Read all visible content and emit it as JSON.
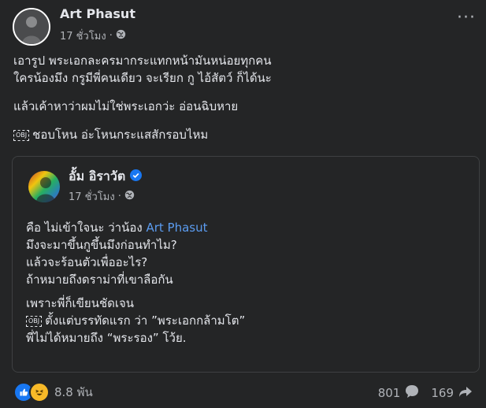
{
  "post": {
    "author": "Art Phasut",
    "time": "17 ชั่วโมง",
    "separator": "·",
    "audience_icon": "globe-icon",
    "body_lines": [
      "เอารูป พระเอกละครมากระแทกหน้ามันหน่อยทุกคน",
      "ใครน้องมึง กรูมีพี่คนเดียว จะเรียก กู ไอ้สัตว์ ก็ได้นะ",
      "แล้วเค้าหาว่าผมไม่ใช่พระเอกว่ะ  อ่อนฉิบหาย",
      "ชอบโหน อ่ะโหนกระแสสักรอบไหม"
    ],
    "obj_label": "OBJ"
  },
  "shared_post": {
    "author": "อั้ม อิราวัต",
    "verified_icon": "verified-badge-icon",
    "time": "17 ชั่วโมง",
    "separator": "·",
    "audience_icon": "globe-icon",
    "line1_prefix": "คือ ไม่เข้าใจนะ ว่าน้อง ",
    "line1_mention": "Art Phasut",
    "lines_a": [
      "มึงจะมาขึ้นกูขึ้นมึงก่อนทำไม?",
      "แล้วจะร้อนตัวเพื่ออะไร?",
      "ถ้าหมายถึงดราม่าที่เขาลือกัน"
    ],
    "lines_b": [
      "เพราะพี่ก็เขียนชัดเจน",
      "ตั้งแต่บรรทัดแรก ว่า ”พระเอกกล้ามโต”",
      "พี่ไม่ได้หมายถึง “พระรอง” โว้ย."
    ]
  },
  "footer": {
    "reaction_icons": [
      "like-icon",
      "haha-icon"
    ],
    "reaction_count": "8.8 พัน",
    "comment_count": "801",
    "share_count": "169"
  },
  "colors": {
    "background": "#242526",
    "text": "#e4e6eb",
    "secondary_text": "#b0b3b8",
    "mention": "#5b9cf0",
    "like_blue": "#1877f2",
    "haha_yellow": "#f7b928"
  }
}
